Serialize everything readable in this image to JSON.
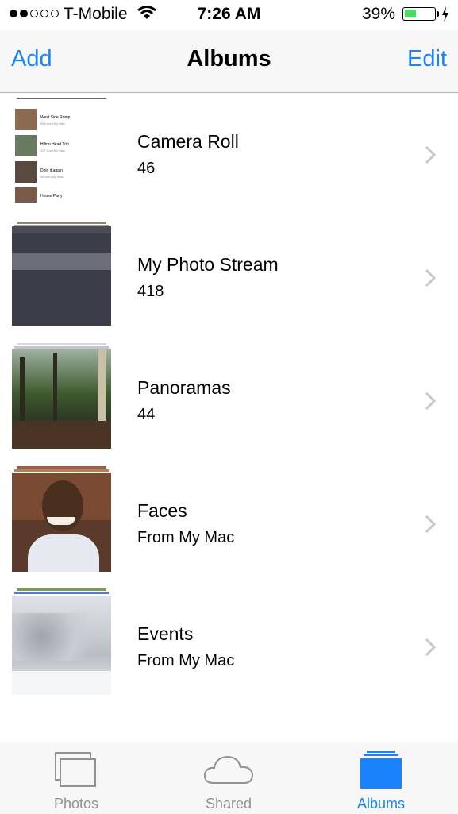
{
  "status_bar": {
    "carrier": "T-Mobile",
    "time": "7:26 AM",
    "battery_percent": "39%",
    "battery_level": 0.39,
    "signal_bars_filled": 2,
    "signal_bars_total": 5
  },
  "nav": {
    "left": "Add",
    "title": "Albums",
    "right": "Edit"
  },
  "albums": [
    {
      "title": "Camera Roll",
      "subtitle": "46",
      "thumb_icon": "camera-roll-thumbnail"
    },
    {
      "title": "My Photo Stream",
      "subtitle": "418",
      "thumb_icon": "photo-stream-thumbnail"
    },
    {
      "title": "Panoramas",
      "subtitle": "44",
      "thumb_icon": "panorama-trees-thumbnail"
    },
    {
      "title": "Faces",
      "subtitle": "From My Mac",
      "thumb_icon": "child-face-thumbnail"
    },
    {
      "title": "Events",
      "subtitle": "From My Mac",
      "thumb_icon": "snowy-trees-thumbnail"
    }
  ],
  "camera_roll_thumb_items": [
    {
      "title": "West Side Romp",
      "sub": "528 from My Mac"
    },
    {
      "title": "Hilton Head Trip",
      "sub": "127 from My Mac"
    },
    {
      "title": "Doin it again",
      "sub": "45 from My Mac"
    },
    {
      "title": "House Party",
      "sub": ""
    }
  ],
  "tabs": [
    {
      "label": "Photos",
      "icon": "photos-tab-icon",
      "active": false
    },
    {
      "label": "Shared",
      "icon": "cloud-icon",
      "active": false
    },
    {
      "label": "Albums",
      "icon": "albums-tab-icon",
      "active": true
    }
  ],
  "colors": {
    "accent": "#1a82fb",
    "inactive_tab": "#929292",
    "battery_fill": "#4cd964"
  }
}
